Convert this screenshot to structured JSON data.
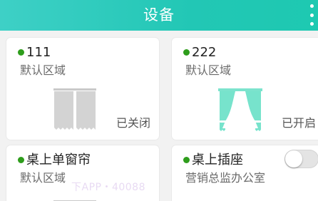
{
  "header": {
    "title": "设备",
    "more_icon": "more-vertical-icon",
    "background": "#22c7b5"
  },
  "colors": {
    "online_dot": "#2e9d1c",
    "curtain_closed": "#c8c8c8",
    "curtain_open": "#77e3cc"
  },
  "devices": [
    {
      "name": "111",
      "room": "默认区域",
      "state": "已关闭",
      "icon": "curtain-closed-icon"
    },
    {
      "name": "222",
      "room": "默认区域",
      "state": "已开启",
      "icon": "curtain-open-icon"
    },
    {
      "name": "桌上单窗帘",
      "room": "默认区域",
      "icon": "curtain-icon"
    },
    {
      "name": "桌上插座",
      "room": "营销总监办公室",
      "icon": "socket-icon",
      "toggle_on": false
    }
  ],
  "watermark": "下APP・40088"
}
